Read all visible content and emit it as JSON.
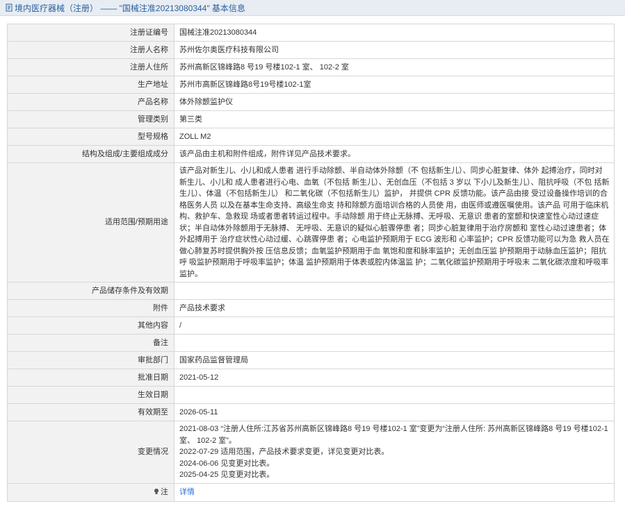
{
  "header": {
    "title": "境内医疗器械（注册）  ——  \"国械注准20213080344\" 基本信息",
    "icon": "document-icon"
  },
  "rows": [
    {
      "key": "注册证编号",
      "value": "国械注准20213080344"
    },
    {
      "key": "注册人名称",
      "value": "苏州佐尔奥医疗科技有限公司"
    },
    {
      "key": "注册人住所",
      "value": "苏州高新区锦峰路8 号19 号楼102-1 室、 102-2 室"
    },
    {
      "key": "生产地址",
      "value": "苏州市高新区锦峰路8号19号楼102-1室"
    },
    {
      "key": "产品名称",
      "value": "体外除颤监护仪"
    },
    {
      "key": "管理类别",
      "value": "第三类"
    },
    {
      "key": "型号规格",
      "value": "ZOLL M2"
    },
    {
      "key": "结构及组成/主要组成成分",
      "value": "该产品由主机和附件组成，附件详见产品技术要求。"
    },
    {
      "key": "适用范围/预期用途",
      "value": "该产品对新生儿、小儿和成人患者 进行手动除颤、半自动体外除颤（不 包括新生儿）、同步心脏复律、体外 起搏治疗，同时对新生儿、小儿和 成人患者进行心电、血氧（不包括 新生儿）、无创血压（不包括 3 岁以 下小儿及新生儿）、阻抗呼吸（不包 括新生儿）、体温（不包括新生儿） 和二氧化碳（不包括新生儿）监护， 并提供 CPR 反馈功能。该产品由接 受过设备操作培训的合格医务人员 以及在基本生命支持、高级生命支 持和除颤方面培训合格的人员使 用，由医师或遵医嘱使用。该产品 可用于临床机构、救护车、急救现 场或者患者转运过程中。手动除颤 用于终止无脉搏、无呼吸、无意识 患者的室颤和快速室性心动过速症 状；半自动体外除颤用于无脉搏、 无呼吸、无意识的疑似心脏骤停患 者；同步心脏复律用于治疗房颤和 室性心动过速患者；体外起搏用于 治疗症状性心动过缓、心跳骤停患 者；心电监护预期用于 ECG 波形和 心率监护；CPR 反馈功能可以为急 救人员在做心肺复苏时提供胸外按 压信息反馈；血氧监护预期用于血 氧饱和度和脉率监护；无创血压监 护预期用于动脉血压监护；阻抗呼 吸监护预期用于呼吸率监护；体温 监护预期用于体表或腔内体温监 护；二氧化碳监护预期用于呼吸末 二氧化碳浓度和呼吸率监护。"
    },
    {
      "key": "产品储存条件及有效期",
      "value": ""
    },
    {
      "key": "附件",
      "value": "产品技术要求"
    },
    {
      "key": "其他内容",
      "value": "/"
    },
    {
      "key": "备注",
      "value": ""
    },
    {
      "key": "审批部门",
      "value": "国家药品监督管理局"
    },
    {
      "key": "批准日期",
      "value": "2021-05-12"
    },
    {
      "key": "生效日期",
      "value": ""
    },
    {
      "key": "有效期至",
      "value": "2026-05-11"
    }
  ],
  "changes": {
    "key": "变更情况",
    "lines": [
      "2021-08-03 “注册人住所:江苏省苏州高新区锦峰路8 号19 号楼102-1 室”变更为“注册人住所: 苏州高新区锦峰路8 号19 号楼102-1 室、 102-2 室”。",
      "2022-07-29 适用范围，产品技术要求变更，详见变更对比表。",
      "2024-06-06 见变更对比表。",
      "2025-04-25 见变更对比表。"
    ]
  },
  "note": {
    "key": "注",
    "icon": "lightbulb-icon",
    "link_label": "详情"
  },
  "colors": {
    "title_bg": "#e8edf3",
    "title_text": "#2a5f9e",
    "key_bg": "#f2f2f2",
    "border": "#d6d6d6",
    "link": "#2a6fd6"
  }
}
